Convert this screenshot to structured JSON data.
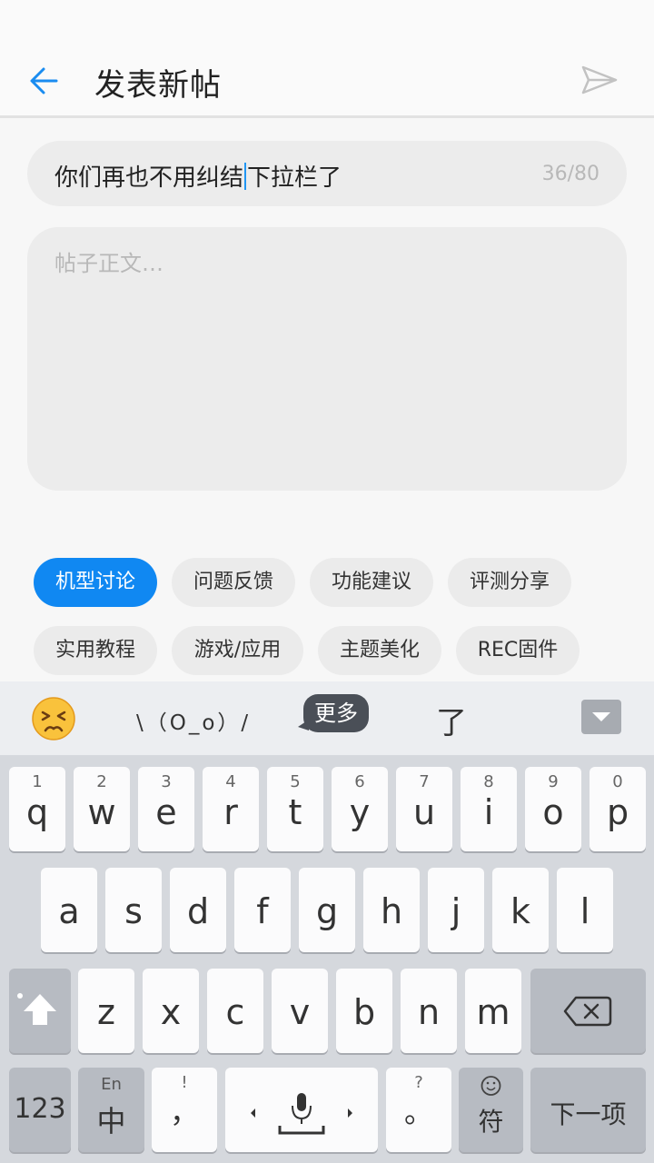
{
  "header": {
    "title": "发表新帖"
  },
  "post": {
    "title_before_caret": "你们再也不用纠结",
    "title_after_caret": "下拉栏了",
    "title_counter": "36/80",
    "body_placeholder": "帖子正文…"
  },
  "tags": [
    {
      "label": "机型讨论",
      "active": true
    },
    {
      "label": "问题反馈",
      "active": false
    },
    {
      "label": "功能建议",
      "active": false
    },
    {
      "label": "评测分享",
      "active": false
    },
    {
      "label": "实用教程",
      "active": false
    },
    {
      "label": "游戏/应用",
      "active": false
    },
    {
      "label": "主题美化",
      "active": false
    },
    {
      "label": "REC固件",
      "active": false
    }
  ],
  "keyboard": {
    "toolbar": {
      "kaomoji": "\\（O_o）/",
      "more_label": "更多",
      "candidate": "了"
    },
    "row1": [
      {
        "num": "1",
        "letter": "q"
      },
      {
        "num": "2",
        "letter": "w"
      },
      {
        "num": "3",
        "letter": "e"
      },
      {
        "num": "4",
        "letter": "r"
      },
      {
        "num": "5",
        "letter": "t"
      },
      {
        "num": "6",
        "letter": "y"
      },
      {
        "num": "7",
        "letter": "u"
      },
      {
        "num": "8",
        "letter": "i"
      },
      {
        "num": "9",
        "letter": "o"
      },
      {
        "num": "0",
        "letter": "p"
      }
    ],
    "row2": [
      "a",
      "s",
      "d",
      "f",
      "g",
      "h",
      "j",
      "k",
      "l"
    ],
    "row3": [
      "z",
      "x",
      "c",
      "v",
      "b",
      "n",
      "m"
    ],
    "bottom": {
      "numbers_label": "123",
      "lang_top": "En",
      "lang_main": "中",
      "punct_top": "!",
      "punct_main": "，",
      "period_top": "?",
      "period_main": "。",
      "symbol_label": "符",
      "next_label": "下一项"
    }
  },
  "colors": {
    "accent": "#1088f2",
    "caret": "#2196f3"
  }
}
